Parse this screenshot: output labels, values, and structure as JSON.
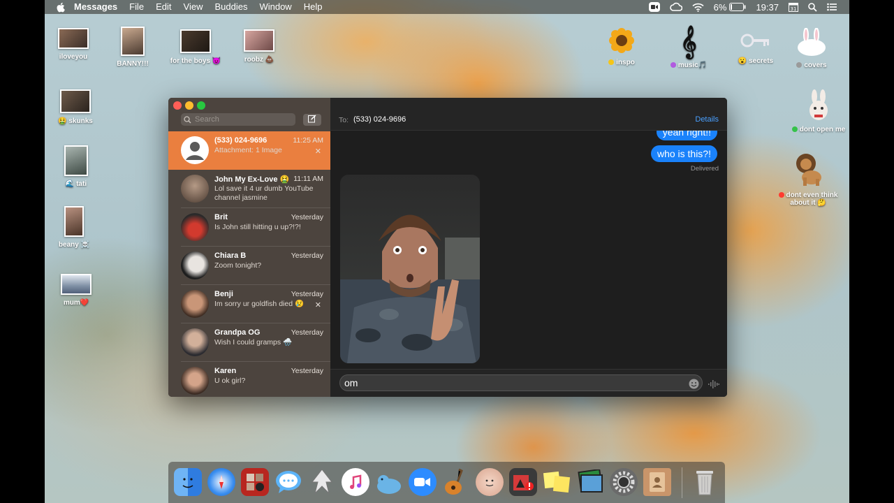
{
  "menubar": {
    "app_name": "Messages",
    "menus": [
      "File",
      "Edit",
      "View",
      "Buddies",
      "Window",
      "Help"
    ],
    "battery": "6%",
    "time": "19:37"
  },
  "desktop": {
    "left_icons": [
      {
        "label": "iloveyou"
      },
      {
        "label": "BANNY!!!"
      },
      {
        "label": "for the boys 😈"
      },
      {
        "label": "roobz 💩"
      },
      {
        "label": "🤮 skunks"
      },
      {
        "label": "🌊 tati"
      },
      {
        "label": "beany ☠️"
      },
      {
        "label": "mum❤️"
      }
    ],
    "right_icons": [
      {
        "label": "inspo",
        "tag_color": "#f5c518"
      },
      {
        "label": "music🎵",
        "tag_color": "#b15be0"
      },
      {
        "label": "😮 secrets"
      },
      {
        "label": "covers",
        "tag_color": "#9a9a9a"
      },
      {
        "label": "dont open me",
        "tag_color": "#35c24a"
      },
      {
        "label": "dont even think about it 🤔",
        "tag_color": "#ff3b30"
      }
    ]
  },
  "sidebar": {
    "search_placeholder": "Search",
    "conversations": [
      {
        "name": "(533) 024-9696",
        "time": "11:25 AM",
        "preview": "Attachment: 1 Image",
        "selected": true
      },
      {
        "name": "John My Ex-Love 🤮",
        "time": "11:11 AM",
        "preview": "Lol save it 4 ur dumb YouTube channel jasmine"
      },
      {
        "name": "Brit",
        "time": "Yesterday",
        "preview": "Is John still hitting u up?!?!"
      },
      {
        "name": "Chiara B",
        "time": "Yesterday",
        "preview": "Zoom tonight?"
      },
      {
        "name": "Benji",
        "time": "Yesterday",
        "preview": "Im sorry ur goldfish died 😢"
      },
      {
        "name": "Grandpa OG",
        "time": "Yesterday",
        "preview": "Wish I could gramps 🌧️"
      },
      {
        "name": "Karen",
        "time": "Yesterday",
        "preview": "U ok girl?"
      }
    ]
  },
  "chat": {
    "to_label": "To:",
    "recipient": "(533) 024-9696",
    "details_label": "Details",
    "messages": [
      {
        "text": "yeah right!!",
        "from": "me"
      },
      {
        "text": "who is this?!",
        "from": "me"
      }
    ],
    "delivered_label": "Delivered",
    "input_value": "om"
  },
  "colors": {
    "selected_row": "#ea7f3f",
    "bubble": "#1a82fb",
    "link": "#4aa0ff"
  },
  "dock": {
    "apps": [
      "finder-icon",
      "safari-icon",
      "photo-booth-icon",
      "messages-icon",
      "inkscape-icon",
      "music-icon",
      "wireshark-icon",
      "zoom-icon",
      "garageband-icon",
      "face-app-icon",
      "photo-app-icon",
      "stickies-icon",
      "preview-icon",
      "system-preferences-icon",
      "contacts-icon",
      "trash-icon"
    ]
  }
}
